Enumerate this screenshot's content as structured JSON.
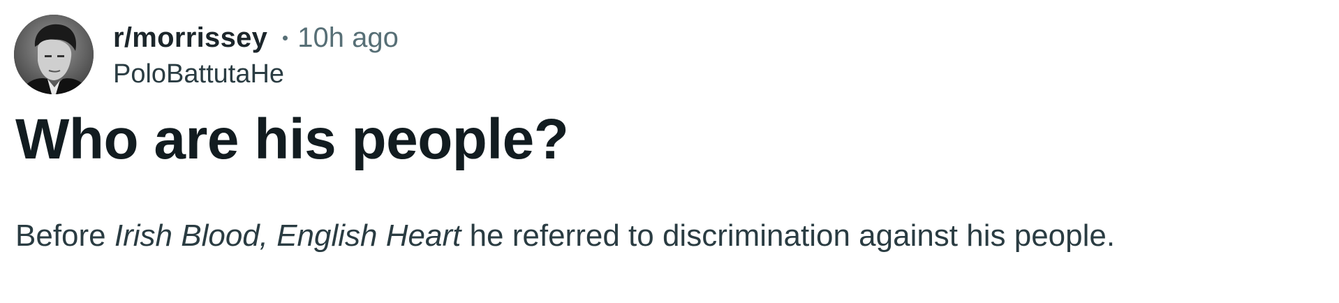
{
  "post": {
    "subreddit": "r/morrissey",
    "time_ago": "10h ago",
    "username": "PoloBattutaHe",
    "avatar_icon": "user-avatar-photo",
    "title": "Who are his people?",
    "body": {
      "before": "Before ",
      "italic": "Irish Blood, English Heart",
      "after": " he referred to discrimination against his people."
    }
  },
  "colors": {
    "title": "#121c20",
    "text": "#2a3c42",
    "meta": "#576f76"
  }
}
